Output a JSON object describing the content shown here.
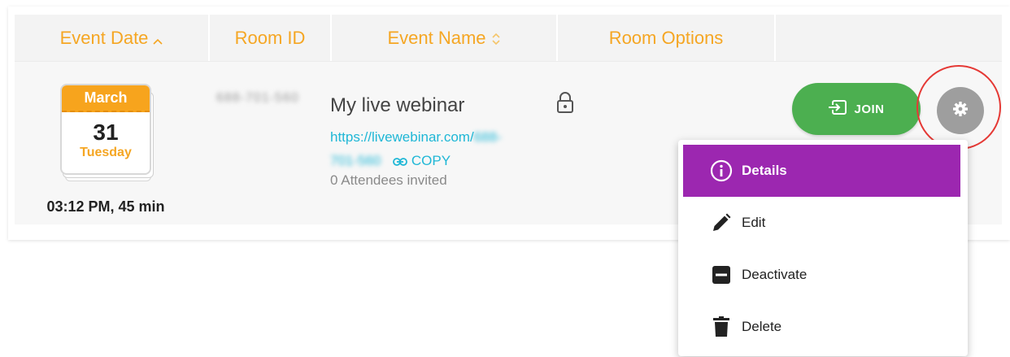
{
  "table": {
    "headers": [
      {
        "label": "Event Date",
        "sort": "asc"
      },
      {
        "label": "Room ID"
      },
      {
        "label": "Event Name",
        "sort": "both"
      },
      {
        "label": "Room Options"
      },
      {
        "label": ""
      }
    ]
  },
  "row": {
    "calendar": {
      "month": "March",
      "day": "31",
      "weekday": "Tuesday"
    },
    "time": "03:12 PM, 45 min",
    "room_id": "688-701-560",
    "event_name": "My live webinar",
    "link_prefix": "https://livewebinar.com/",
    "link_id_part1": "688-",
    "link_id_part2": "701-560",
    "copy_label": "COPY",
    "attendees": "0 Attendees invited",
    "room_options_icon": "lock-icon",
    "join_label": "JOIN"
  },
  "menu": {
    "items": [
      {
        "label": "Details",
        "icon": "info-icon",
        "active": true
      },
      {
        "label": "Edit",
        "icon": "pencil-icon"
      },
      {
        "label": "Deactivate",
        "icon": "minus-box-icon"
      },
      {
        "label": "Delete",
        "icon": "trash-icon"
      }
    ]
  },
  "colors": {
    "accent": "#f5a623",
    "join": "#4caf50",
    "menu_active": "#9c27b0",
    "link": "#1fb7d6",
    "highlight": "#e53935"
  }
}
